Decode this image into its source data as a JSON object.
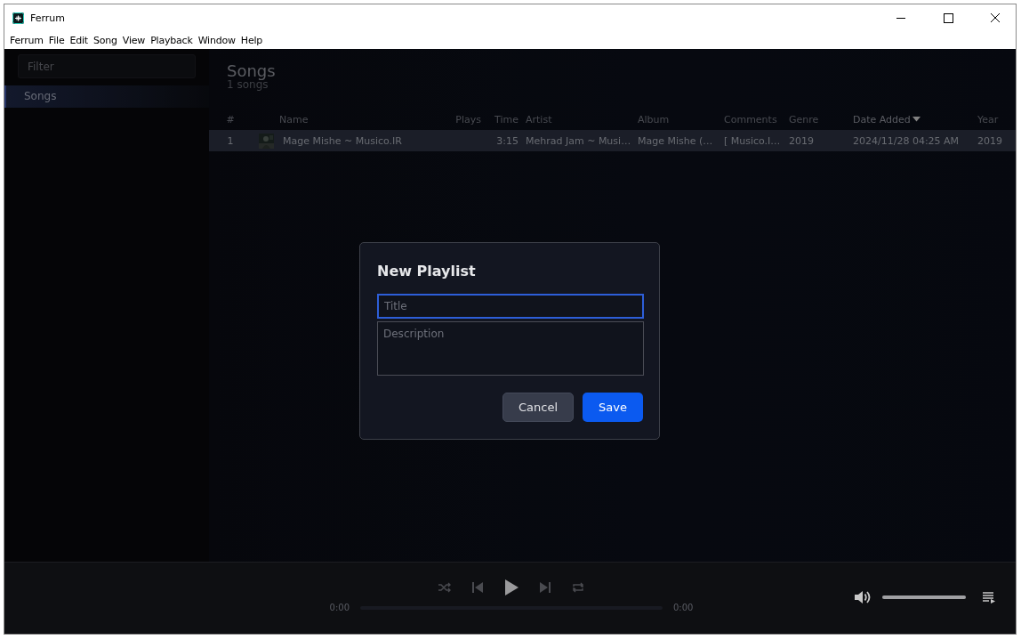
{
  "window": {
    "title": "Ferrum"
  },
  "menu": [
    "Ferrum",
    "File",
    "Edit",
    "Song",
    "View",
    "Playback",
    "Window",
    "Help"
  ],
  "sidebar": {
    "filter": {
      "placeholder": "Filter"
    },
    "items": [
      {
        "label": "Songs",
        "selected": true
      }
    ]
  },
  "page": {
    "title": "Songs",
    "subtitle": "1 songs"
  },
  "table": {
    "columns": [
      {
        "label": "#",
        "sorted": false
      },
      {
        "label": "Name",
        "sorted": false
      },
      {
        "label": "Plays",
        "sorted": false
      },
      {
        "label": "Time",
        "sorted": false
      },
      {
        "label": "Artist",
        "sorted": false
      },
      {
        "label": "Album",
        "sorted": false
      },
      {
        "label": "Comments",
        "sorted": false
      },
      {
        "label": "Genre",
        "sorted": false
      },
      {
        "label": "Date Added",
        "sorted": true
      },
      {
        "label": "Year",
        "sorted": false
      }
    ],
    "rows": [
      {
        "selected": true,
        "cells": [
          "1",
          "Mage Mishe ~ Musico.IR",
          "",
          "3:15",
          "Mehrad Jam ~ Musi…",
          "Mage Mishe (…",
          "[ Musico.I…",
          "2019",
          "2024/11/28 04:25 AM",
          "2019"
        ]
      }
    ]
  },
  "dialog": {
    "title": "New Playlist",
    "fields": [
      {
        "placeholder": "Title",
        "focused": true,
        "kind": "line"
      },
      {
        "placeholder": "Description",
        "focused": false,
        "kind": "area"
      }
    ],
    "buttons": [
      {
        "label": "Cancel",
        "kind": "secondary"
      },
      {
        "label": "Save",
        "kind": "primary"
      }
    ]
  },
  "player": {
    "elapsed": "0:00",
    "total": "0:00",
    "volume": {
      "level": 1
    }
  }
}
